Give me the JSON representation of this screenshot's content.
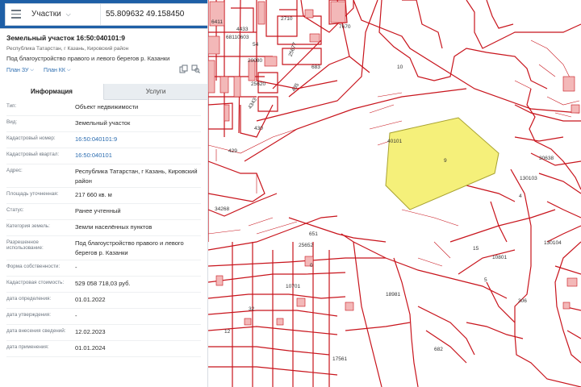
{
  "search": {
    "mode": "Участки",
    "query": "55.809632 49.158450",
    "clear": "✕"
  },
  "parcel": {
    "title": "Земельный участок 16:50:040101:9",
    "location": "Республика Татарстан, г Казань, Кировский район",
    "purpose": "Под благоустройство правого и левого берегов р. Казанки",
    "plans": [
      {
        "label": "План ЗУ"
      },
      {
        "label": "План КК"
      }
    ]
  },
  "tabs": [
    {
      "label": "Информация",
      "active": true
    },
    {
      "label": "Услуги",
      "active": false
    }
  ],
  "info": [
    {
      "label": "Тип:",
      "value": "Объект недвижимости"
    },
    {
      "label": "Вид:",
      "value": "Земельный участок"
    },
    {
      "label": "Кадастровый номер:",
      "value": "16:50:040101:9"
    },
    {
      "label": "Кадастровый квартал:",
      "value": "16:50:040101"
    },
    {
      "label": "Адрес:",
      "value": "Республика Татарстан, г Казань, Кировский район"
    },
    {
      "label": "Площадь уточненная:",
      "value": "217 660 кв. м"
    },
    {
      "label": "Статус:",
      "value": "Ранее учтенный"
    },
    {
      "label": "Категория земель:",
      "value": "Земли населённых пунктов"
    },
    {
      "label": "Разрешенное использование:",
      "value": "Под благоустройство правого и левого берегов р. Казанки"
    },
    {
      "label": "Форма собственности:",
      "value": "-"
    },
    {
      "label": "Кадастровая стоимость:",
      "value": "529 058 718,03 руб."
    },
    {
      "label": "дата определения:",
      "value": "01.01.2022"
    },
    {
      "label": "дата утверждения:",
      "value": "-"
    },
    {
      "label": "дата внесения сведений:",
      "value": "12.02.2023"
    },
    {
      "label": "дата применения:",
      "value": "01.01.2024"
    }
  ],
  "map": {
    "labels": [
      "6411",
      "4433",
      "2710",
      "7670",
      "68110603",
      "54",
      "25677",
      "20080",
      "683",
      "25620",
      "435",
      "10",
      "4343",
      "430",
      "429",
      "40101",
      "9",
      "30638",
      "130103",
      "4",
      "34268",
      "25652",
      "651",
      "0",
      "15",
      "10801",
      "130104",
      "18981",
      "10701",
      "32",
      "12",
      "5",
      "306",
      "682",
      "17561"
    ],
    "colors": {
      "parcel_line": "#c8141c",
      "selected_fill": "#f5f07a",
      "building": "#f3b8b8"
    }
  }
}
